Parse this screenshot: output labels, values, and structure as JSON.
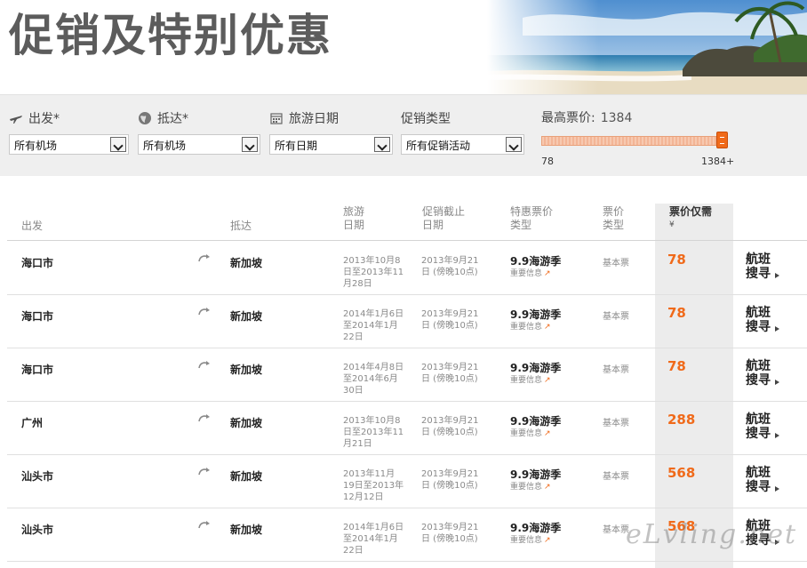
{
  "header": {
    "title": "促销及特别优惠"
  },
  "filters": [
    {
      "label": "出发*",
      "icon": "plane-icon",
      "value": "所有机场"
    },
    {
      "label": "抵达*",
      "icon": "globe-icon",
      "value": "所有机场"
    },
    {
      "label": "旅游日期",
      "icon": "calendar-icon",
      "value": "所有日期"
    },
    {
      "label": "促销类型",
      "icon": "",
      "value": "所有促销活动"
    }
  ],
  "price_filter": {
    "label": "最高票价:",
    "value": "1384",
    "min_label": "78",
    "max_label": "1384+",
    "min": 78,
    "max": 1384,
    "current": 1384
  },
  "table": {
    "headers": {
      "origin": "出发",
      "dest": "抵达",
      "travel": "旅游\n日期",
      "deadline": "促销截止\n日期",
      "type": "特惠票价\n类型",
      "fare": "票价\n类型",
      "price": "票价仅需",
      "price_unit": "¥"
    },
    "rows": [
      {
        "origin": "海口市",
        "dest": "新加坡",
        "travel": "2013年10月8日至2013年11月28日",
        "deadline": "2013年9月21日 (傍晚10点)",
        "type": "9.9海游季",
        "type_info": "重要信息",
        "fare": "基本票",
        "price": "78",
        "search": "航班搜寻"
      },
      {
        "origin": "海口市",
        "dest": "新加坡",
        "travel": "2014年1月6日至2014年1月22日",
        "deadline": "2013年9月21日 (傍晚10点)",
        "type": "9.9海游季",
        "type_info": "重要信息",
        "fare": "基本票",
        "price": "78",
        "search": "航班搜寻"
      },
      {
        "origin": "海口市",
        "dest": "新加坡",
        "travel": "2014年4月8日至2014年6月30日",
        "deadline": "2013年9月21日 (傍晚10点)",
        "type": "9.9海游季",
        "type_info": "重要信息",
        "fare": "基本票",
        "price": "78",
        "search": "航班搜寻"
      },
      {
        "origin": "广州",
        "dest": "新加坡",
        "travel": "2013年10月8日至2013年11月21日",
        "deadline": "2013年9月21日 (傍晚10点)",
        "type": "9.9海游季",
        "type_info": "重要信息",
        "fare": "基本票",
        "price": "288",
        "search": "航班搜寻"
      },
      {
        "origin": "汕头市",
        "dest": "新加坡",
        "travel": "2013年11月19日至2013年12月12日",
        "deadline": "2013年9月21日 (傍晚10点)",
        "type": "9.9海游季",
        "type_info": "重要信息",
        "fare": "基本票",
        "price": "568",
        "search": "航班搜寻"
      },
      {
        "origin": "汕头市",
        "dest": "新加坡",
        "travel": "2014年1月6日至2014年1月22日",
        "deadline": "2013年9月21日 (傍晚10点)",
        "type": "9.9海游季",
        "type_info": "重要信息",
        "fare": "基本票",
        "price": "568",
        "search": "航班搜寻"
      }
    ]
  },
  "watermark": "eLvling.net",
  "colors": {
    "accent": "#f06a1a",
    "title": "#5c5c5c",
    "filterbar": "#efefef"
  }
}
